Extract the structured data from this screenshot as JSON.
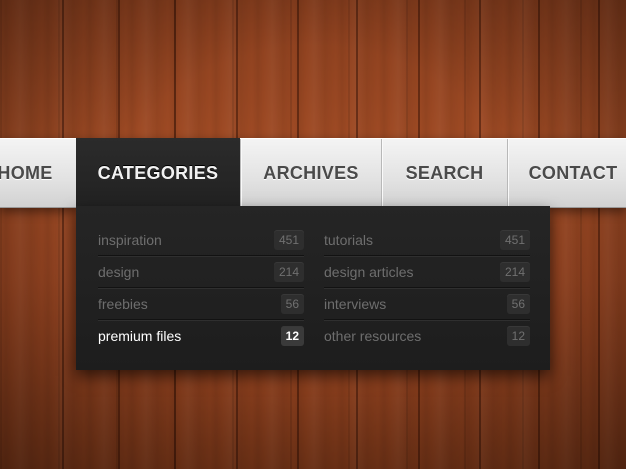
{
  "nav": {
    "items": [
      {
        "label": "HOME"
      },
      {
        "label": "CATEGORIES"
      },
      {
        "label": "ARCHIVES"
      },
      {
        "label": "SEARCH"
      },
      {
        "label": "CONTACT"
      }
    ],
    "active_index": 1
  },
  "dropdown": {
    "left_column": [
      {
        "label": "inspiration",
        "count": "451"
      },
      {
        "label": "design",
        "count": "214"
      },
      {
        "label": "freebies",
        "count": "56"
      },
      {
        "label": "premium files",
        "count": "12"
      }
    ],
    "right_column": [
      {
        "label": "tutorials",
        "count": "451"
      },
      {
        "label": "design articles",
        "count": "214"
      },
      {
        "label": "interviews",
        "count": "56"
      },
      {
        "label": "other resources",
        "count": "12"
      }
    ],
    "active_item": "premium files"
  },
  "colors": {
    "wood": "#9a4622",
    "nav_bg": "#e2e2e2",
    "nav_text": "#4a4a4a",
    "active_bg": "#222222",
    "panel_bg": "#1f1f1f",
    "muted_text": "#6e6e6e",
    "active_text": "#ffffff"
  }
}
